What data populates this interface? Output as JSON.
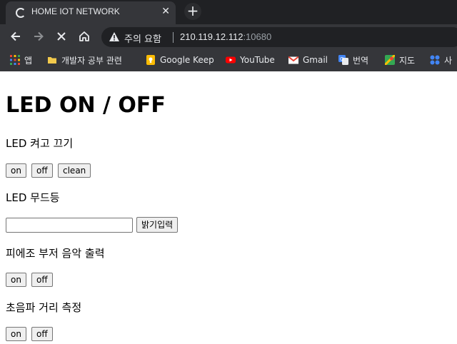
{
  "browser": {
    "tab": {
      "title": "HOME IOT NETWORK",
      "close_glyph": "✕",
      "icon": "loading-spinner-icon"
    },
    "new_tab_glyph": "+",
    "nav": {
      "back_icon": "back-arrow-icon",
      "forward_icon": "forward-arrow-icon",
      "stop_icon": "stop-icon",
      "home_icon": "home-icon"
    },
    "address": {
      "warning_label": "주의 요함",
      "host": "210.119.12.112",
      "port": ":10680"
    },
    "bookmarks": [
      {
        "label": "앱",
        "icon": "apps-grid-icon"
      },
      {
        "label": "개발자 공부 관련",
        "icon": "folder-icon"
      },
      {
        "label": "Google Keep",
        "icon": "google-keep-icon"
      },
      {
        "label": "YouTube",
        "icon": "youtube-icon"
      },
      {
        "label": "Gmail",
        "icon": "gmail-icon"
      },
      {
        "label": "번역",
        "icon": "translate-icon"
      },
      {
        "label": "지도",
        "icon": "maps-icon"
      },
      {
        "label": "사",
        "icon": "apps-dots-icon"
      }
    ]
  },
  "page": {
    "heading": "LED ON / OFF",
    "led_section": {
      "label": "LED 켜고 끄기",
      "on": "on",
      "off": "off",
      "clean": "clean"
    },
    "mood_section": {
      "label": "LED 무드등",
      "input_value": "",
      "submit": "밝기입력"
    },
    "buzzer_section": {
      "label": "피에조 부저 음악 출력",
      "on": "on",
      "off": "off"
    },
    "ultrasonic_section": {
      "label": "초음파 거리 측정",
      "on": "on",
      "off": "off"
    }
  },
  "colors": {
    "tabstrip": "#202124",
    "toolbar": "#35363a",
    "omnibox": "#202124",
    "chrome_text": "#e8eaed",
    "youtube_red": "#ff0000",
    "keep_yellow": "#fbbc04",
    "folder_yellow": "#f2c94c"
  }
}
